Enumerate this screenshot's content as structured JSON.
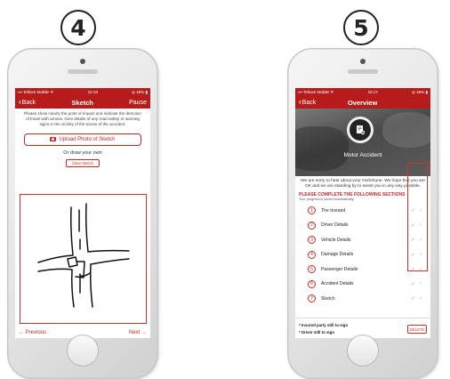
{
  "steps": {
    "left": "4",
    "right": "5"
  },
  "status_bar": {
    "left": {
      "carrier": "Telkom-Mobile",
      "time": "10:18",
      "battery": "45%"
    },
    "right": {
      "carrier": "Telkom-Mobile",
      "time": "10:17",
      "battery": "46%"
    }
  },
  "sketch_screen": {
    "back_label": "Back",
    "title": "Sketch",
    "pause_label": "Pause",
    "instructions": "Please show clearly the point of impact and indicate the direction of travel with arrows. Give details of any road safety or warning signs in the vicinity of the scene of the accident.",
    "upload_label": "Upload Photo of Sketch",
    "or_draw_label": "Or draw your own",
    "clear_label": "Clear Sketch",
    "previous_label": "Previous",
    "next_label": "Next"
  },
  "overview_screen": {
    "back_label": "Back",
    "title": "Overview",
    "hero_title": "Motor Accident",
    "sorry_text": "We are sorry to hear about your misfortune. We hope that you are OK and we are standing by to assist you in any way possible.",
    "complete_title": "PLEASE COMPLETE THE FOLLOWING SECTIONS",
    "progress_note": "Your progress is saved automatically.",
    "sections": [
      {
        "num": "1",
        "label": "The Insured"
      },
      {
        "num": "2",
        "label": "Driver Details"
      },
      {
        "num": "3",
        "label": "Vehicle Details"
      },
      {
        "num": "4",
        "label": "Damage Details"
      },
      {
        "num": "5",
        "label": "Passenger Details"
      },
      {
        "num": "6",
        "label": "Accident Details"
      },
      {
        "num": "7",
        "label": "Sketch"
      }
    ],
    "footer_line1": "* Insured party still to sign",
    "footer_line2": "* Driver still to sign",
    "delete_label": "DELETE"
  },
  "colors": {
    "brand_red": "#b71c1c",
    "highlight_red": "#d32f2f",
    "check_green": "#7cbf7c"
  }
}
